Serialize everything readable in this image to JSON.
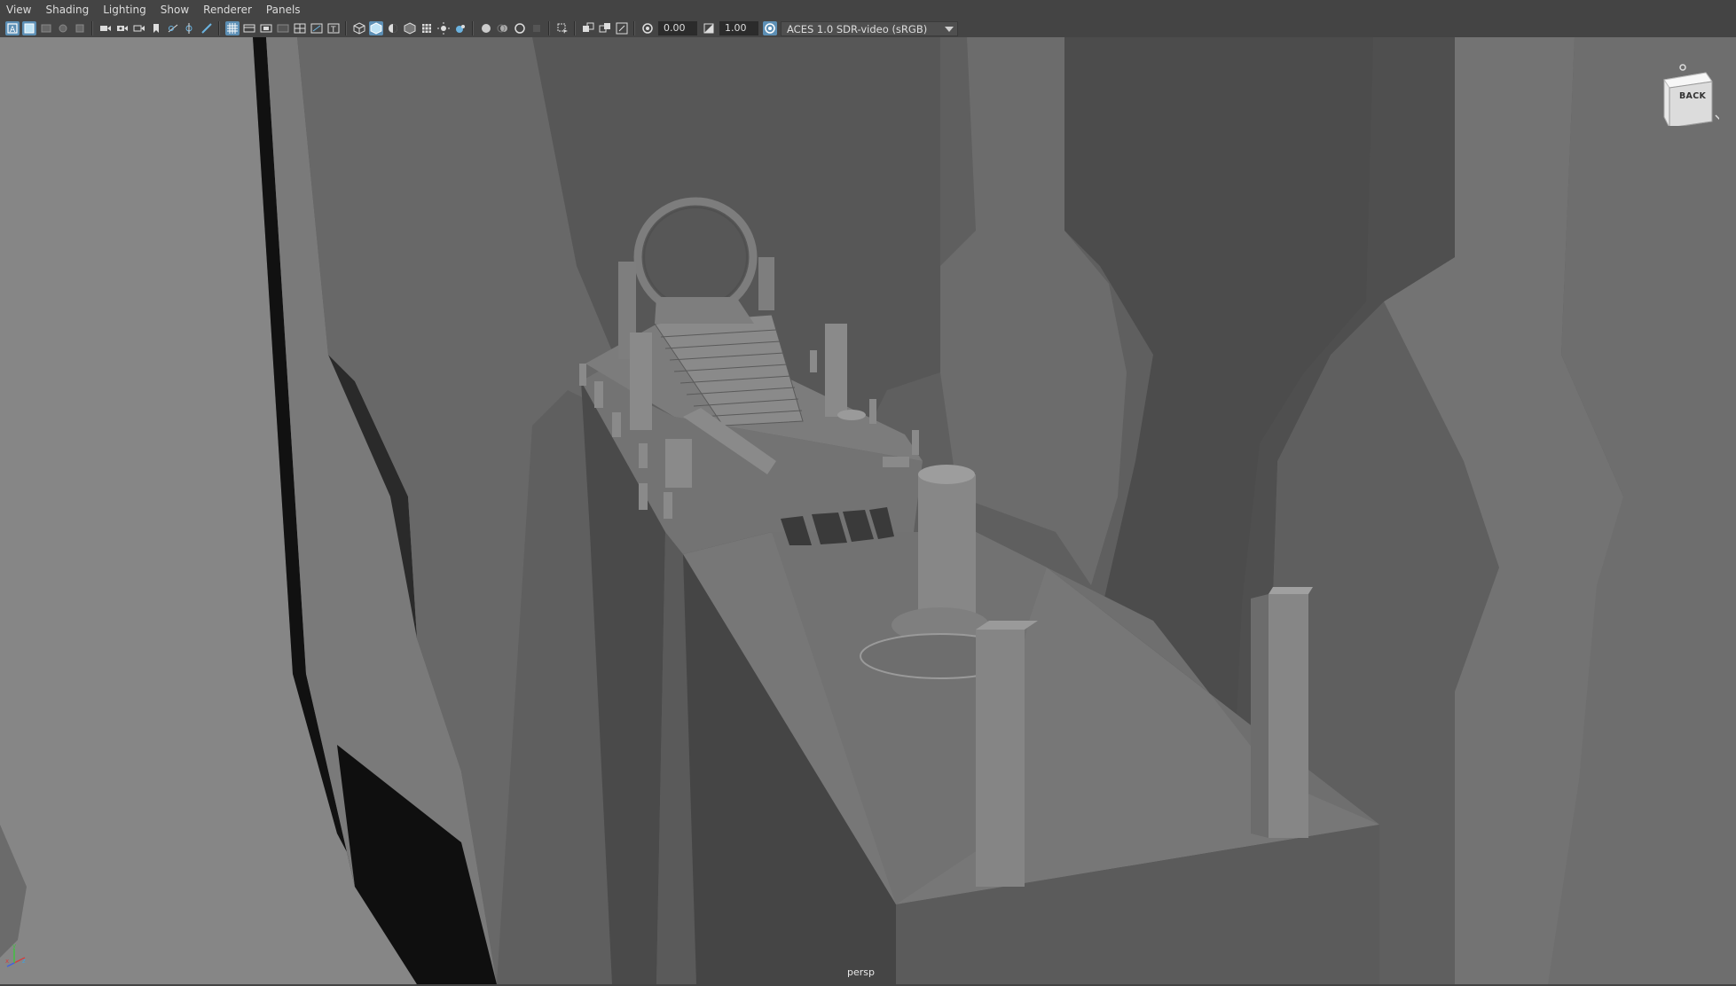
{
  "menubar": {
    "items": [
      "View",
      "Shading",
      "Lighting",
      "Show",
      "Renderer",
      "Panels"
    ]
  },
  "toolbar": {
    "icons_group1": [
      "select-camera-icon",
      "camera-attributes-icon",
      "bookmark-icon",
      "image-plane-icon",
      "grease-pencil-icon"
    ],
    "icons_group2": [
      "camera-icon",
      "camera-lock-icon",
      "camera-tumble-icon",
      "bookmark-flag-icon",
      "pan-zoom-icon",
      "pencil-icon",
      "brush-icon"
    ],
    "icons_group3": [
      "grid-icon",
      "film-gate-icon",
      "resolution-gate-icon",
      "gate-mask-icon",
      "field-chart-icon",
      "safe-action-icon",
      "safe-title-icon"
    ],
    "icons_group4": [
      "wireframe-icon",
      "smooth-shade-icon",
      "wireframe-on-shaded-icon",
      "textured-icon",
      "use-all-lights-icon",
      "shadows-icon",
      "ambient-occlusion-icon"
    ],
    "icons_group5": [
      "screen-space-ao-icon",
      "motion-blur-icon",
      "multisample-aa-icon",
      "depth-of-field-icon"
    ],
    "icons_group6": [
      "isolate-select-icon",
      "xray-icon",
      "xray-joints-icon",
      "xray-components-icon"
    ],
    "exposure_value": "0.00",
    "gamma_value": "1.00",
    "color_space": "ACES 1.0 SDR-video (sRGB)"
  },
  "viewport": {
    "camera_label": "persp",
    "viewcube_face": "BACK"
  },
  "colors": {
    "ui_background": "#444444",
    "active_icon": "#5c8fb5",
    "viewport_background": "#5e5e5e"
  }
}
